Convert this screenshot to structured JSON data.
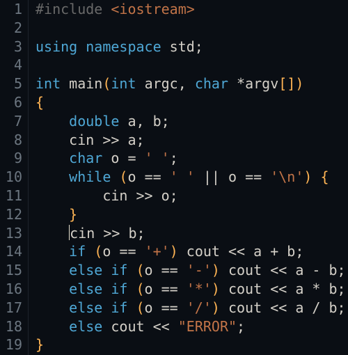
{
  "language": "cpp",
  "lines": [
    {
      "num": 1,
      "tokens": [
        {
          "t": "#include ",
          "c": "tok-pp"
        },
        {
          "t": "<iostream>",
          "c": "tok-inc"
        }
      ]
    },
    {
      "num": 2,
      "tokens": []
    },
    {
      "num": 3,
      "tokens": [
        {
          "t": "using namespace ",
          "c": "tok-kw"
        },
        {
          "t": "std",
          "c": "tok-plain"
        },
        {
          "t": ";",
          "c": "tok-punct"
        }
      ]
    },
    {
      "num": 4,
      "tokens": []
    },
    {
      "num": 5,
      "tokens": [
        {
          "t": "int ",
          "c": "tok-type"
        },
        {
          "t": "main",
          "c": "tok-plain"
        },
        {
          "t": "(",
          "c": "tok-paren"
        },
        {
          "t": "int ",
          "c": "tok-type"
        },
        {
          "t": "argc",
          "c": "tok-plain"
        },
        {
          "t": ", ",
          "c": "tok-punct"
        },
        {
          "t": "char ",
          "c": "tok-type"
        },
        {
          "t": "*argv",
          "c": "tok-plain"
        },
        {
          "t": "[",
          "c": "tok-paren"
        },
        {
          "t": "]",
          "c": "tok-paren"
        },
        {
          "t": ")",
          "c": "tok-paren"
        }
      ]
    },
    {
      "num": 6,
      "tokens": [
        {
          "t": "{",
          "c": "tok-brace"
        }
      ]
    },
    {
      "num": 7,
      "tokens": [
        {
          "t": "    ",
          "c": ""
        },
        {
          "t": "double ",
          "c": "tok-type"
        },
        {
          "t": "a",
          "c": "tok-plain"
        },
        {
          "t": ", ",
          "c": "tok-punct"
        },
        {
          "t": "b",
          "c": "tok-plain"
        },
        {
          "t": ";",
          "c": "tok-punct"
        }
      ]
    },
    {
      "num": 8,
      "tokens": [
        {
          "t": "    ",
          "c": ""
        },
        {
          "t": "cin ",
          "c": "tok-plain"
        },
        {
          "t": ">> ",
          "c": "tok-op"
        },
        {
          "t": "a",
          "c": "tok-plain"
        },
        {
          "t": ";",
          "c": "tok-punct"
        }
      ]
    },
    {
      "num": 9,
      "tokens": [
        {
          "t": "    ",
          "c": ""
        },
        {
          "t": "char ",
          "c": "tok-type"
        },
        {
          "t": "o ",
          "c": "tok-plain"
        },
        {
          "t": "= ",
          "c": "tok-op"
        },
        {
          "t": "' '",
          "c": "tok-chr"
        },
        {
          "t": ";",
          "c": "tok-punct"
        }
      ]
    },
    {
      "num": 10,
      "tokens": [
        {
          "t": "    ",
          "c": ""
        },
        {
          "t": "while ",
          "c": "tok-kw"
        },
        {
          "t": "(",
          "c": "tok-paren"
        },
        {
          "t": "o ",
          "c": "tok-plain"
        },
        {
          "t": "== ",
          "c": "tok-op"
        },
        {
          "t": "' '",
          "c": "tok-chr"
        },
        {
          "t": " || ",
          "c": "tok-op"
        },
        {
          "t": "o ",
          "c": "tok-plain"
        },
        {
          "t": "== ",
          "c": "tok-op"
        },
        {
          "t": "'\\n'",
          "c": "tok-chr"
        },
        {
          "t": ")",
          "c": "tok-paren"
        },
        {
          "t": " {",
          "c": "tok-brace"
        }
      ]
    },
    {
      "num": 11,
      "tokens": [
        {
          "t": "        ",
          "c": ""
        },
        {
          "t": "cin ",
          "c": "tok-plain"
        },
        {
          "t": ">> ",
          "c": "tok-op"
        },
        {
          "t": "o",
          "c": "tok-plain"
        },
        {
          "t": ";",
          "c": "tok-punct"
        }
      ]
    },
    {
      "num": 12,
      "tokens": [
        {
          "t": "    ",
          "c": ""
        },
        {
          "t": "}",
          "c": "tok-brace"
        }
      ]
    },
    {
      "num": 13,
      "cursor_before": true,
      "indent": "    ",
      "tokens": [
        {
          "t": "cin ",
          "c": "tok-plain"
        },
        {
          "t": ">> ",
          "c": "tok-op"
        },
        {
          "t": "b",
          "c": "tok-plain"
        },
        {
          "t": ";",
          "c": "tok-punct"
        }
      ]
    },
    {
      "num": 14,
      "tokens": [
        {
          "t": "    ",
          "c": ""
        },
        {
          "t": "if ",
          "c": "tok-kw"
        },
        {
          "t": "(",
          "c": "tok-paren"
        },
        {
          "t": "o ",
          "c": "tok-plain"
        },
        {
          "t": "== ",
          "c": "tok-op"
        },
        {
          "t": "'+'",
          "c": "tok-chr"
        },
        {
          "t": ")",
          "c": "tok-paren"
        },
        {
          "t": " cout ",
          "c": "tok-plain"
        },
        {
          "t": "<< ",
          "c": "tok-op"
        },
        {
          "t": "a ",
          "c": "tok-plain"
        },
        {
          "t": "+ ",
          "c": "tok-op"
        },
        {
          "t": "b",
          "c": "tok-plain"
        },
        {
          "t": ";",
          "c": "tok-punct"
        }
      ]
    },
    {
      "num": 15,
      "tokens": [
        {
          "t": "    ",
          "c": ""
        },
        {
          "t": "else if ",
          "c": "tok-kw"
        },
        {
          "t": "(",
          "c": "tok-paren"
        },
        {
          "t": "o ",
          "c": "tok-plain"
        },
        {
          "t": "== ",
          "c": "tok-op"
        },
        {
          "t": "'-'",
          "c": "tok-chr"
        },
        {
          "t": ")",
          "c": "tok-paren"
        },
        {
          "t": " cout ",
          "c": "tok-plain"
        },
        {
          "t": "<< ",
          "c": "tok-op"
        },
        {
          "t": "a ",
          "c": "tok-plain"
        },
        {
          "t": "- ",
          "c": "tok-op"
        },
        {
          "t": "b",
          "c": "tok-plain"
        },
        {
          "t": ";",
          "c": "tok-punct"
        }
      ]
    },
    {
      "num": 16,
      "tokens": [
        {
          "t": "    ",
          "c": ""
        },
        {
          "t": "else if ",
          "c": "tok-kw"
        },
        {
          "t": "(",
          "c": "tok-paren"
        },
        {
          "t": "o ",
          "c": "tok-plain"
        },
        {
          "t": "== ",
          "c": "tok-op"
        },
        {
          "t": "'*'",
          "c": "tok-chr"
        },
        {
          "t": ")",
          "c": "tok-paren"
        },
        {
          "t": " cout ",
          "c": "tok-plain"
        },
        {
          "t": "<< ",
          "c": "tok-op"
        },
        {
          "t": "a ",
          "c": "tok-plain"
        },
        {
          "t": "* ",
          "c": "tok-op"
        },
        {
          "t": "b",
          "c": "tok-plain"
        },
        {
          "t": ";",
          "c": "tok-punct"
        }
      ]
    },
    {
      "num": 17,
      "tokens": [
        {
          "t": "    ",
          "c": ""
        },
        {
          "t": "else if ",
          "c": "tok-kw"
        },
        {
          "t": "(",
          "c": "tok-paren"
        },
        {
          "t": "o ",
          "c": "tok-plain"
        },
        {
          "t": "== ",
          "c": "tok-op"
        },
        {
          "t": "'/'",
          "c": "tok-chr"
        },
        {
          "t": ")",
          "c": "tok-paren"
        },
        {
          "t": " cout ",
          "c": "tok-plain"
        },
        {
          "t": "<< ",
          "c": "tok-op"
        },
        {
          "t": "a ",
          "c": "tok-plain"
        },
        {
          "t": "/ ",
          "c": "tok-op"
        },
        {
          "t": "b",
          "c": "tok-plain"
        },
        {
          "t": ";",
          "c": "tok-punct"
        }
      ]
    },
    {
      "num": 18,
      "tokens": [
        {
          "t": "    ",
          "c": ""
        },
        {
          "t": "else ",
          "c": "tok-kw"
        },
        {
          "t": "cout ",
          "c": "tok-plain"
        },
        {
          "t": "<< ",
          "c": "tok-op"
        },
        {
          "t": "\"ERROR\"",
          "c": "tok-str"
        },
        {
          "t": ";",
          "c": "tok-punct"
        }
      ]
    },
    {
      "num": 19,
      "tokens": [
        {
          "t": "}",
          "c": "tok-brace"
        }
      ]
    }
  ]
}
